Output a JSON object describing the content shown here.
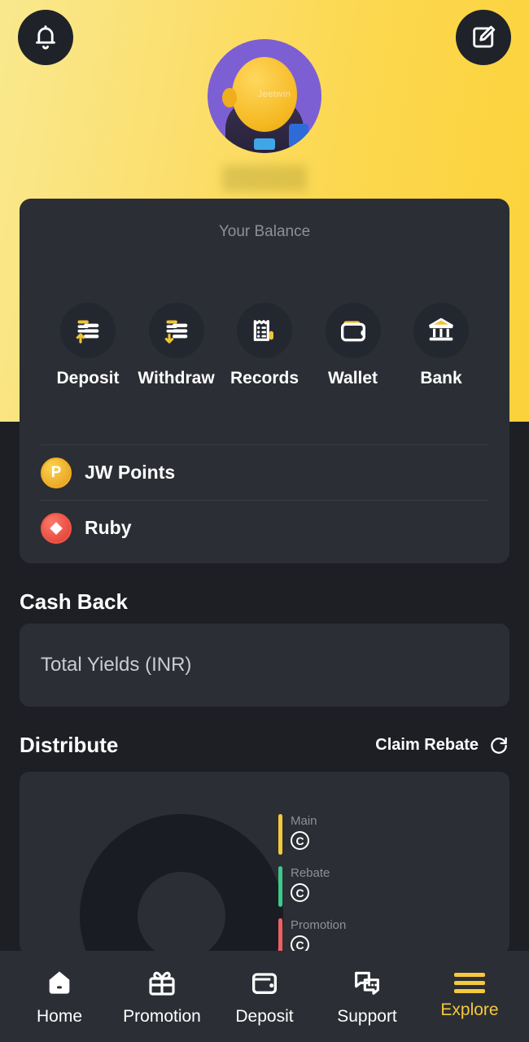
{
  "header": {
    "bell_icon": "bell-icon",
    "edit_icon": "edit-profile-icon",
    "avatar_alt": "user-avatar",
    "avatar_logo_text": "Jeetwin",
    "username_masked": ""
  },
  "balance": {
    "title": "Your Balance",
    "actions": [
      {
        "label": "Deposit",
        "icon": "money-stack-up-icon"
      },
      {
        "label": "Withdraw",
        "icon": "money-stack-down-icon"
      },
      {
        "label": "Records",
        "icon": "receipt-icon"
      },
      {
        "label": "Wallet",
        "icon": "wallet-icon"
      },
      {
        "label": "Bank",
        "icon": "bank-icon"
      }
    ],
    "coins": [
      {
        "label": "JW Points",
        "icon": "jw-points-coin-icon",
        "glyph": "P",
        "color": "#f0ad21"
      },
      {
        "label": "Ruby",
        "icon": "ruby-gem-icon",
        "glyph": "◆",
        "color": "#ef5646"
      }
    ]
  },
  "cashback": {
    "title": "Cash Back",
    "total_yields_label": "Total Yields (INR)"
  },
  "distribute": {
    "title": "Distribute",
    "claim_label": "Claim Rebate",
    "refresh_icon": "refresh-icon"
  },
  "chart_data": {
    "type": "pie",
    "title": "Distribute",
    "legend_position": "right",
    "categories": [
      "Main",
      "Rebate",
      "Promotion"
    ],
    "values": [
      null,
      null,
      null
    ],
    "colors": [
      "#f5c93c",
      "#3cc98a",
      "#ef6060"
    ],
    "value_labels": [
      "C",
      "C",
      "C"
    ],
    "note": "donut chart rendered as empty placeholder; per-slice amounts not displayed"
  },
  "bottom_nav": [
    {
      "label": "Home",
      "icon": "home-icon",
      "accent": false
    },
    {
      "label": "Promotion",
      "icon": "gift-icon",
      "accent": false
    },
    {
      "label": "Deposit",
      "icon": "wallet-icon",
      "accent": false
    },
    {
      "label": "Support",
      "icon": "chat-icon",
      "accent": false
    },
    {
      "label": "Explore",
      "icon": "menu-icon",
      "accent": true
    }
  ],
  "colors": {
    "brand_yellow": "#fbd43e",
    "card_bg": "#2b2e34",
    "page_bg": "#1d1f25",
    "avatar_purple": "#7d5fd4"
  }
}
